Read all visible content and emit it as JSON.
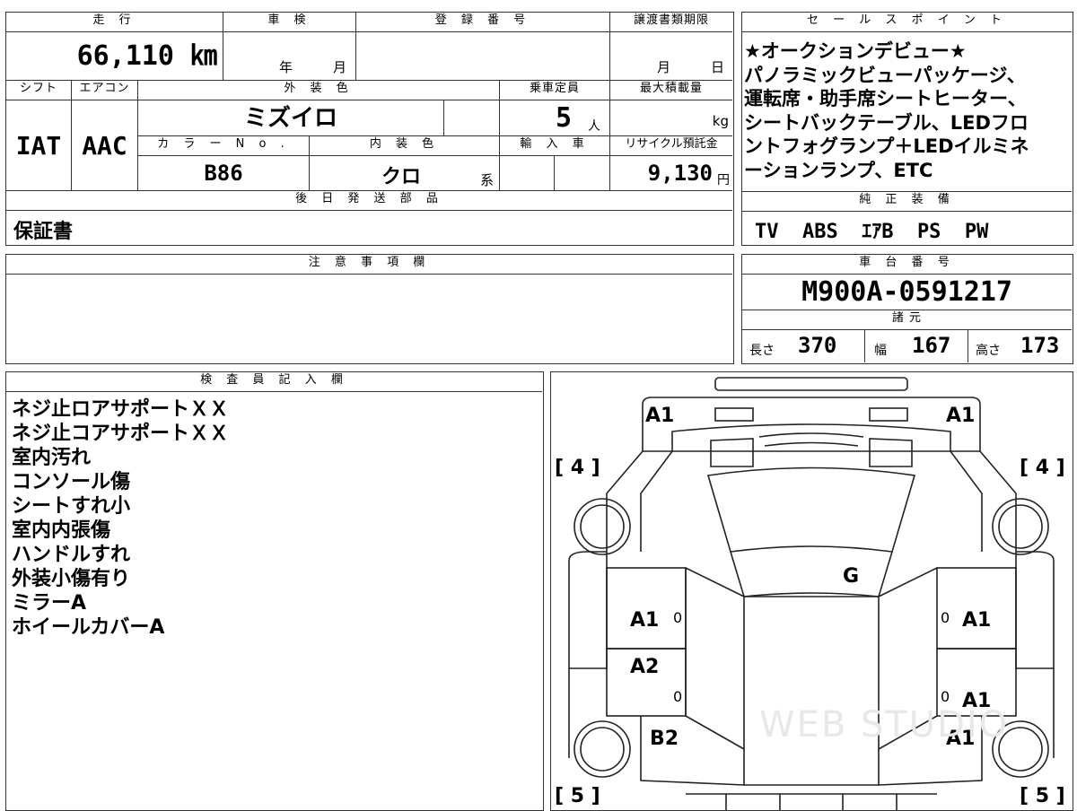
{
  "headers": {
    "mileage": "走 行",
    "inspection": "車 検",
    "registration": "登 録 番 号",
    "transfer_deadline": "譲渡書類期限",
    "shift": "シフト",
    "aircon": "エアコン",
    "exterior_color": "外 装 色",
    "capacity": "乗車定員",
    "max_load": "最大積載量",
    "color_no": "カ ラ ー N o .",
    "interior_color": "内 装 色",
    "import": "輸 入 車",
    "recycle": "リサイクル預託金",
    "later_parts": "後 日 発 送 部 品",
    "sales_point": "セ ー ル ス ポ イ ン ト",
    "equipment": "純 正 装 備",
    "caution": "注 意 事 項 欄",
    "chassis_no": "車 台 番 号",
    "specs": "諸 元",
    "inspector": "検 査 員 記 入 欄"
  },
  "values": {
    "mileage": "66,110 ㎞",
    "inspection_year": "年",
    "inspection_month": "月",
    "transfer_month": "月",
    "transfer_day": "日",
    "shift": "IAT",
    "aircon": "AAC",
    "exterior_color": "ミズイロ",
    "capacity": "5",
    "capacity_unit": "人",
    "max_load_unit": "kg",
    "color_no": "B86",
    "interior_color": "クロ",
    "interior_suffix": "系",
    "recycle": "9,130",
    "recycle_unit": "円",
    "later_parts": "保証書",
    "chassis_no": "M900A-0591217",
    "length_label": "長さ",
    "length": "370",
    "width_label": "幅",
    "width": "167",
    "height_label": "高さ",
    "height": "173"
  },
  "sales_point_lines": [
    "★オークションデビュー★",
    "パノラミックビューパッケージ、",
    "運転席・助手席シートヒーター、",
    "シートバックテーブル、LEDフロ",
    "ントフォグランプ＋LEDイルミネ",
    "ーションランプ、ETC"
  ],
  "equipment": "TV  ABS  ｴｱB  PS  PW",
  "inspector_notes": [
    "ネジ止ロアサポートＸＸ",
    "ネジ止コアサポートＸＸ",
    "室内汚れ",
    "コンソール傷",
    "シートすれ小",
    "室内内張傷",
    "ハンドルすれ",
    "外装小傷有り",
    "ミラーA",
    "ホイールカバーA"
  ],
  "diagram": {
    "front_left": "A1",
    "front_right": "A1",
    "tire_fl": "[ 4 ]",
    "tire_fr": "[ 4 ]",
    "tire_rl": "[ 5 ]",
    "tire_rr": "[ 5 ]",
    "windshield": "G",
    "door_fl": "A1",
    "door_fr": "A1",
    "door_rl": "A2",
    "door_rr": "A1",
    "quarter_l": "B2",
    "quarter_r": "A1",
    "zero1": "0",
    "zero2": "0",
    "zero3": "0",
    "zero4": "0",
    "watermark": "WEB STUDIO"
  }
}
